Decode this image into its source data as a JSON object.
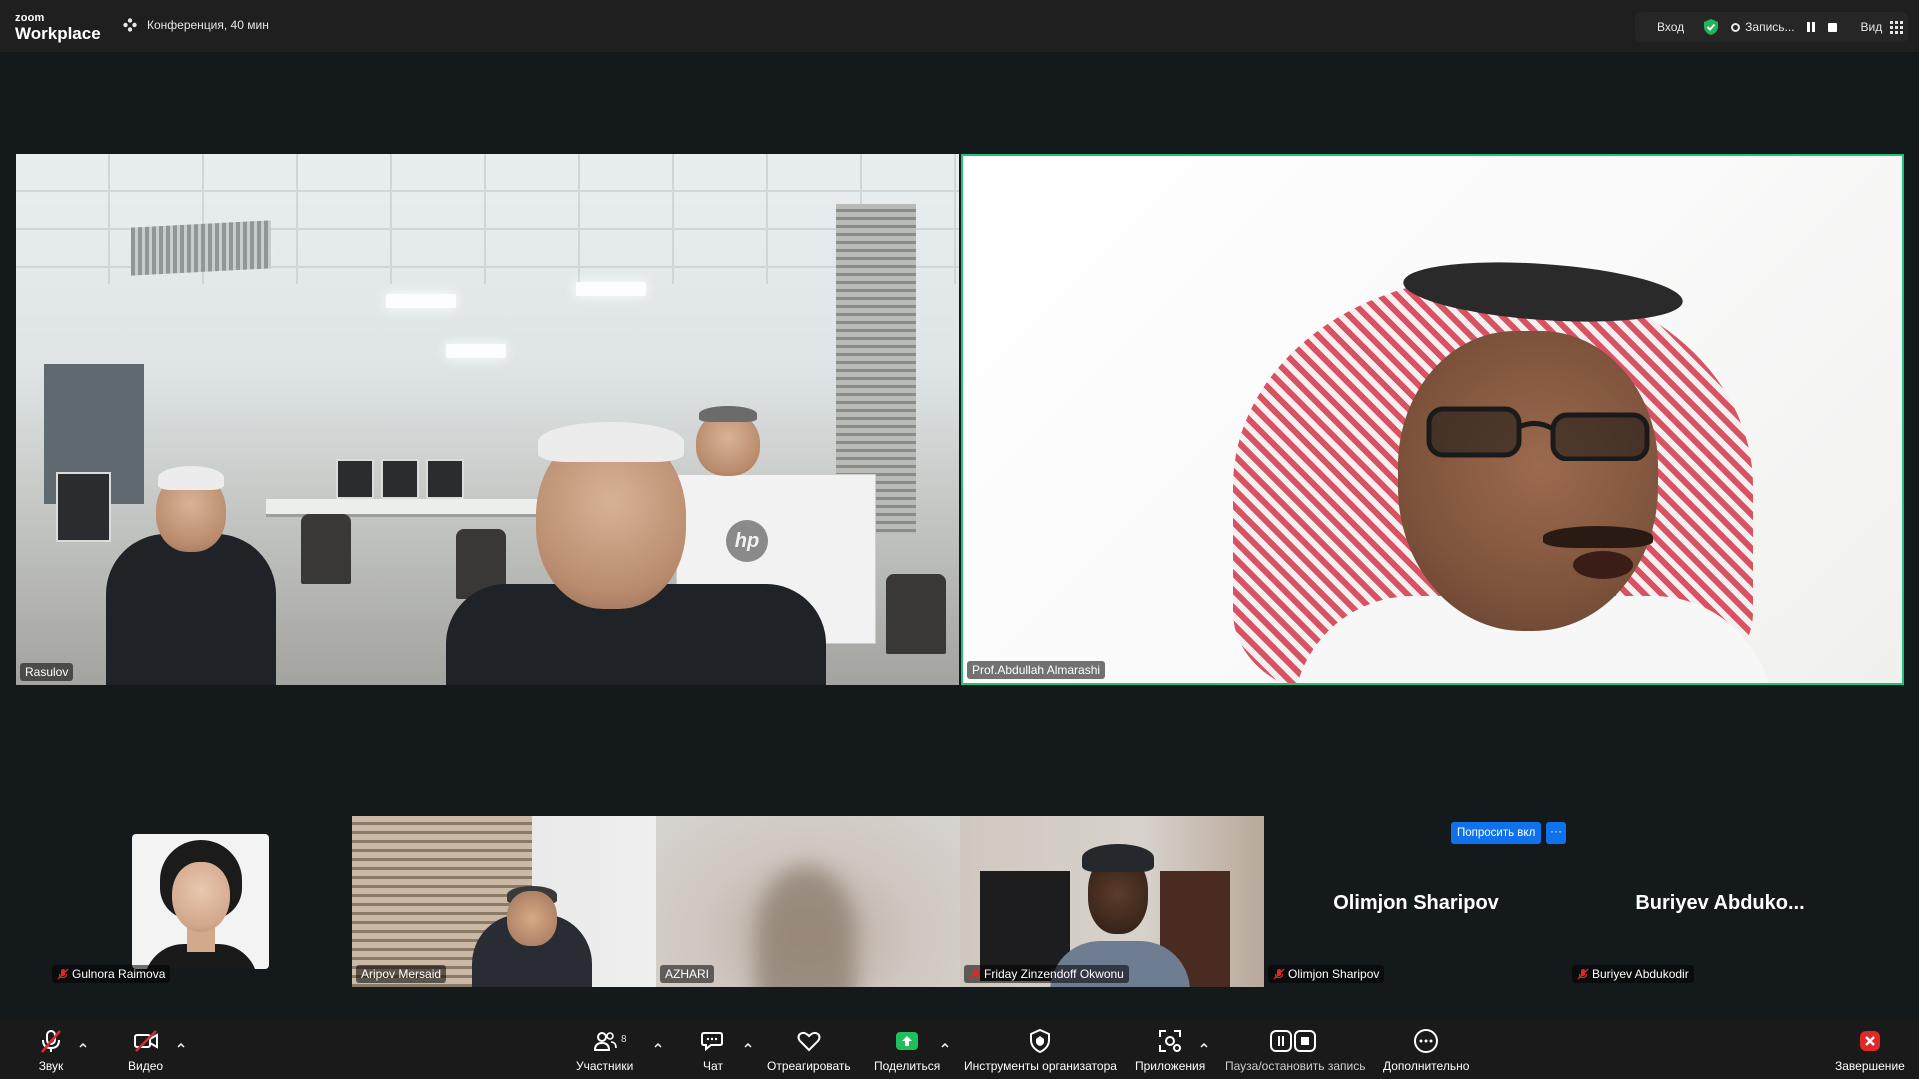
{
  "app": {
    "logo_small": "zoom",
    "logo_big": "Workplace",
    "meeting_title": "Конференция, 40 мин"
  },
  "top_right": {
    "signin": "Вход",
    "record_label": "Запись...",
    "view_label": "Вид"
  },
  "participants": {
    "large": [
      {
        "name": "Rasulov"
      },
      {
        "name": "Prof.Abdullah Almarashi",
        "active_speaker": true
      }
    ],
    "gallery": [
      {
        "name": "Gulnora Raimova",
        "muted": true,
        "has_photo_avatar": true
      },
      {
        "name": "Aripov Mersaid",
        "muted": false
      },
      {
        "name": "AZHARI",
        "muted": false
      },
      {
        "name": "Friday Zinzendoff Okwonu",
        "muted": true
      },
      {
        "name": "Olimjon Sharipov",
        "muted": true,
        "display": "Olimjon Sharipov",
        "video_off": true
      },
      {
        "name": "Buriyev Abdukodir",
        "muted": true,
        "display": "Buriyev  Abduko...",
        "video_off": true
      }
    ],
    "ask_button": "Попросить вкл",
    "more_button": "···"
  },
  "toolbar": {
    "audio": "Звук",
    "video": "Видео",
    "participants": "Участники",
    "participants_count": "8",
    "chat": "Чат",
    "react": "Отреагировать",
    "share": "Поделиться",
    "host_tools": "Инструменты организатора",
    "apps": "Приложения",
    "pause_stop_record": "Пауза/остановить запись",
    "more": "Дополнительно",
    "end": "Завершение"
  },
  "colors": {
    "active_speaker_border": "#21c37a",
    "accent_blue": "#0e72ed",
    "share_green": "#1fbf5b",
    "end_red": "#e02828",
    "muted_red": "#e02828"
  }
}
